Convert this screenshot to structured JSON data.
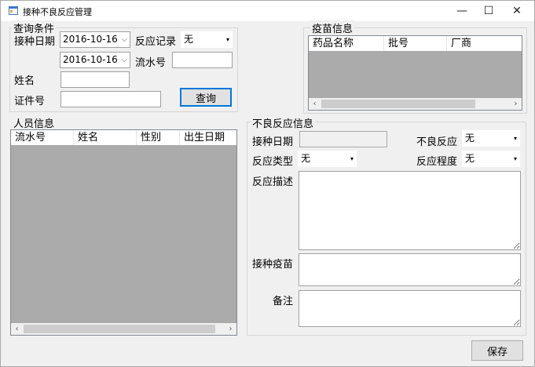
{
  "window": {
    "title": "接种不良反应管理",
    "minimize": "—",
    "maximize": "☐",
    "close": "✕"
  },
  "query": {
    "group_title": "查询条件",
    "vacc_date_label": "接种日期",
    "date_from": "2016-10-16",
    "date_to": "2016-10-16",
    "reaction_record_label": "反应记录",
    "reaction_record_value": "无",
    "serial_label": "流水号",
    "serial_value": "",
    "name_label": "姓名",
    "name_value": "",
    "id_label": "证件号",
    "id_value": "",
    "query_button": "查询"
  },
  "vaccine": {
    "group_title": "疫苗信息",
    "columns": [
      "药品名称",
      "批号",
      "厂商"
    ]
  },
  "person": {
    "group_title": "人员信息",
    "columns": [
      "流水号",
      "姓名",
      "性别",
      "出生日期"
    ]
  },
  "reaction": {
    "group_title": "不良反应信息",
    "vacc_date_label": "接种日期",
    "vacc_date_value": "",
    "adverse_label": "不良反应",
    "adverse_value": "无",
    "type_label": "反应类型",
    "type_value": "无",
    "severity_label": "反应程度",
    "severity_value": "无",
    "desc_label": "反应描述",
    "vaccine_label": "接种疫苗",
    "remark_label": "备注"
  },
  "save_button": "保存",
  "icons": {
    "combo_arrow": "▾",
    "date_arrow": "⌵",
    "scroll_left": "‹",
    "scroll_right": "›"
  }
}
